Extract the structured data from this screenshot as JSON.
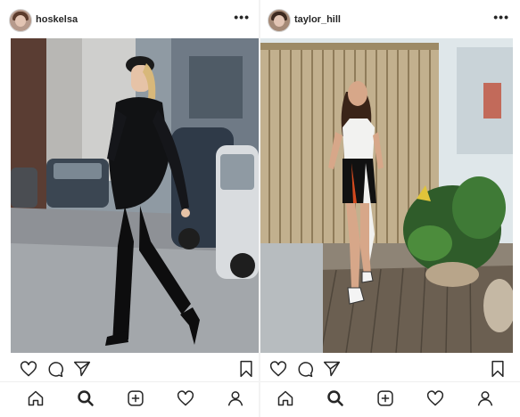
{
  "posts": [
    {
      "username": "hoskelsa",
      "more_icon": "more-options-icon",
      "more_label": "•••"
    },
    {
      "username": "taylor_hill",
      "more_icon": "more-options-icon",
      "more_label": "•••"
    }
  ],
  "actions": [
    "heart-icon",
    "comment-icon",
    "share-icon",
    "bookmark-icon"
  ],
  "bottom_nav": [
    "home-icon",
    "search-icon",
    "add-post-icon",
    "activity-heart-icon",
    "profile-icon"
  ],
  "colors": {
    "text": "#262626",
    "background": "#ffffff",
    "divider": "#efefef"
  }
}
